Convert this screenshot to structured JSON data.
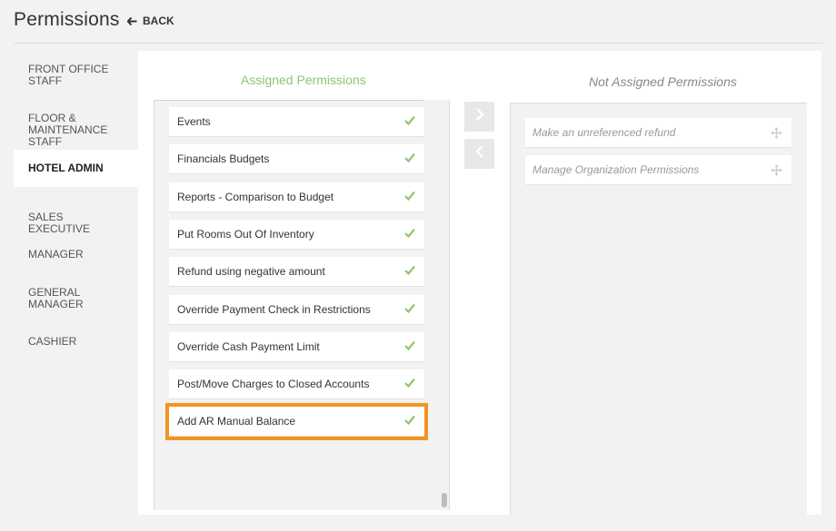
{
  "header": {
    "title": "Permissions",
    "back_label": "BACK"
  },
  "sidebar": {
    "items": [
      {
        "label_lines": [
          "FRONT OFFICE",
          "STAFF"
        ],
        "active": false
      },
      {
        "label_lines": [
          "FLOOR &",
          "MAINTENANCE",
          "STAFF"
        ],
        "active": false
      },
      {
        "label_lines": [
          "HOTEL ADMIN"
        ],
        "active": true
      },
      {
        "label_lines": [
          "SALES EXECUTIVE"
        ],
        "active": false
      },
      {
        "label_lines": [
          "MANAGER"
        ],
        "active": false
      },
      {
        "label_lines": [
          "GENERAL",
          "MANAGER"
        ],
        "active": false
      },
      {
        "label_lines": [
          "CASHIER"
        ],
        "active": false
      }
    ]
  },
  "assigned": {
    "title": "Assigned Permissions",
    "items": [
      {
        "label": "Events"
      },
      {
        "label": "Financials Budgets"
      },
      {
        "label": "Reports - Comparison to Budget"
      },
      {
        "label": "Put Rooms Out Of Inventory"
      },
      {
        "label": "Refund using negative amount"
      },
      {
        "label": "Override Payment Check in Restrictions"
      },
      {
        "label": "Override Cash Payment Limit"
      },
      {
        "label": "Post/Move Charges to Closed Accounts"
      },
      {
        "label": "Add AR Manual Balance",
        "highlighted": true
      }
    ]
  },
  "not_assigned": {
    "title": "Not Assigned Permissions",
    "items": [
      {
        "label": "Make an unreferenced refund"
      },
      {
        "label": "Manage Organization Permissions"
      }
    ]
  },
  "colors": {
    "accent_green": "#8dc572",
    "highlight_orange": "#f39322"
  }
}
